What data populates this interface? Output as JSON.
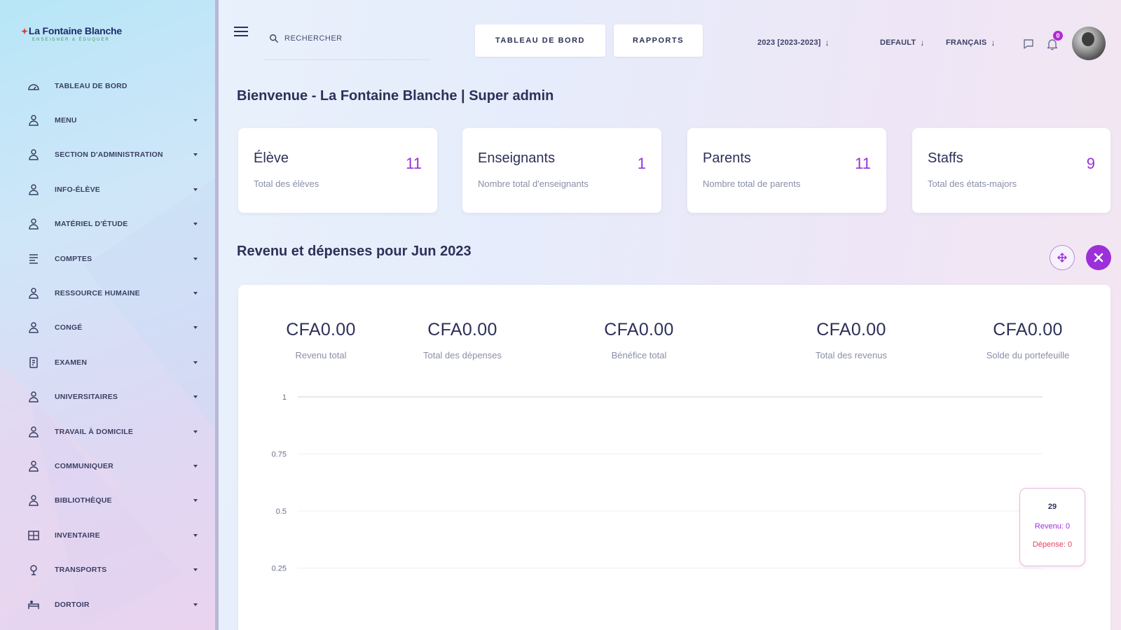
{
  "brand": {
    "name": "La Fontaine Blanche",
    "tagline": "ENSEIGNER & ÉDUQUER"
  },
  "sidebar": {
    "items": [
      {
        "label": "TABLEAU DE BORD",
        "icon": "dashboard-icon",
        "has_caret": false
      },
      {
        "label": "MENU",
        "icon": "person-icon",
        "has_caret": true
      },
      {
        "label": "SECTION D'ADMINISTRATION",
        "icon": "admin-icon",
        "has_caret": true
      },
      {
        "label": "INFO-ÉLÈVE",
        "icon": "student-icon",
        "has_caret": true
      },
      {
        "label": "MATÉRIEL D'ÉTUDE",
        "icon": "study-material-icon",
        "has_caret": true
      },
      {
        "label": "COMPTES",
        "icon": "accounts-icon",
        "has_caret": true
      },
      {
        "label": "RESSOURCE HUMAINE",
        "icon": "hr-icon",
        "has_caret": true
      },
      {
        "label": "CONGÉ",
        "icon": "leave-icon",
        "has_caret": true
      },
      {
        "label": "EXAMEN",
        "icon": "exam-icon",
        "has_caret": true
      },
      {
        "label": "UNIVERSITAIRES",
        "icon": "academic-icon",
        "has_caret": true
      },
      {
        "label": "TRAVAIL À DOMICILE",
        "icon": "homework-icon",
        "has_caret": true
      },
      {
        "label": "COMMUNIQUER",
        "icon": "communicate-icon",
        "has_caret": true
      },
      {
        "label": "BIBLIOTHÈQUE",
        "icon": "library-icon",
        "has_caret": true
      },
      {
        "label": "INVENTAIRE",
        "icon": "inventory-icon",
        "has_caret": true
      },
      {
        "label": "TRANSPORTS",
        "icon": "transport-icon",
        "has_caret": true
      },
      {
        "label": "DORTOIR",
        "icon": "dormitory-icon",
        "has_caret": true
      }
    ]
  },
  "header": {
    "search_placeholder": "RECHERCHER",
    "btn_dashboard": "TABLEAU DE BORD",
    "btn_reports": "RAPPORTS",
    "year_select": "2023 [2023-2023]",
    "theme_select": "DEFAULT",
    "lang_select": "FRANÇAIS",
    "notification_count": "0",
    "select_arrow": "↓"
  },
  "main": {
    "welcome": "Bienvenue - La Fontaine Blanche | Super admin",
    "stats": [
      {
        "title": "Élève",
        "value": "11",
        "subtitle": "Total des élèves"
      },
      {
        "title": "Enseignants",
        "value": "1",
        "subtitle": "Nombre total d'enseignants"
      },
      {
        "title": "Parents",
        "value": "11",
        "subtitle": "Nombre total de parents"
      },
      {
        "title": "Staffs",
        "value": "9",
        "subtitle": "Total des états-majors"
      }
    ],
    "section_title": "Revenu et dépenses pour Jun 2023",
    "metrics": [
      {
        "value": "CFA0.00",
        "label": "Revenu total"
      },
      {
        "value": "CFA0.00",
        "label": "Total des dépenses"
      },
      {
        "value": "CFA0.00",
        "label": "Bénéfice total"
      },
      {
        "value": "CFA0.00",
        "label": "Total des revenus"
      },
      {
        "value": "CFA0.00",
        "label": "Solde du portefeuille"
      }
    ],
    "tooltip": {
      "x": "29",
      "revenue": "Revenu: 0",
      "expense": "Dépense: 0"
    }
  },
  "colors": {
    "accent": "#9b2fd9",
    "text": "#2d3158",
    "muted": "#8a8ea8",
    "expense": "#e4405f"
  },
  "chart_data": {
    "type": "line",
    "title": "",
    "xlabel": "",
    "ylabel": "",
    "ylim": [
      0,
      1
    ],
    "yticks": [
      "1",
      "0.75",
      "0.5",
      "0.25"
    ],
    "grid": true,
    "series": [
      {
        "name": "Revenu",
        "values": [
          0
        ]
      },
      {
        "name": "Dépense",
        "values": [
          0
        ]
      }
    ]
  }
}
